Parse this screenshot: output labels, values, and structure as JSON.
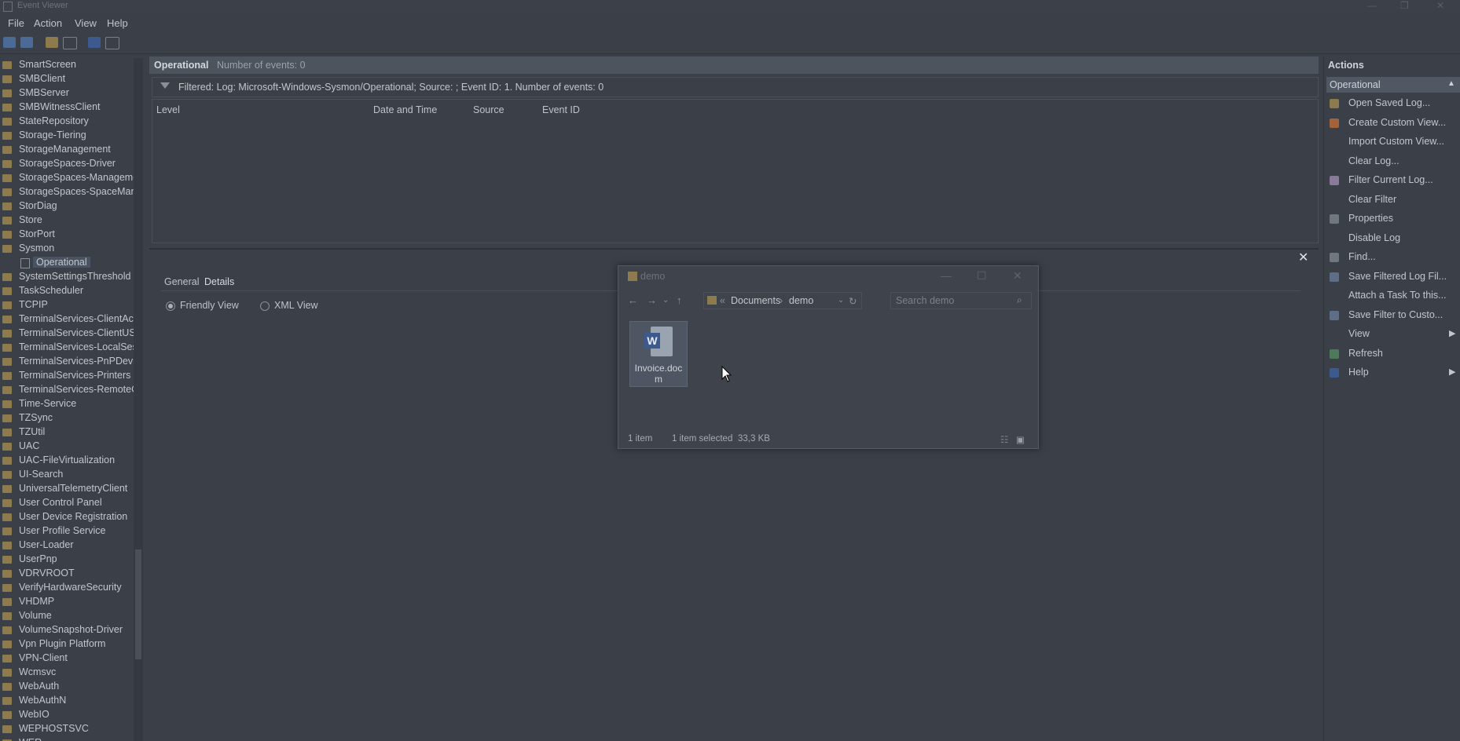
{
  "window": {
    "title": "Event Viewer"
  },
  "menu": [
    "File",
    "Action",
    "View",
    "Help"
  ],
  "tree": {
    "items": [
      "SmartScreen",
      "SMBClient",
      "SMBServer",
      "SMBWitnessClient",
      "StateRepository",
      "Storage-Tiering",
      "StorageManagement",
      "StorageSpaces-Driver",
      "StorageSpaces-Manageme",
      "StorageSpaces-SpaceMana",
      "StorDiag",
      "Store",
      "StorPort",
      "Sysmon",
      "Operational",
      "SystemSettingsThreshold",
      "TaskScheduler",
      "TCPIP",
      "TerminalServices-ClientAct",
      "TerminalServices-ClientUSE",
      "TerminalServices-LocalSess",
      "TerminalServices-PnPDevic",
      "TerminalServices-Printers",
      "TerminalServices-RemoteC",
      "Time-Service",
      "TZSync",
      "TZUtil",
      "UAC",
      "UAC-FileVirtualization",
      "UI-Search",
      "UniversalTelemetryClient",
      "User Control Panel",
      "User Device Registration",
      "User Profile Service",
      "User-Loader",
      "UserPnp",
      "VDRVROOT",
      "VerifyHardwareSecurity",
      "VHDMP",
      "Volume",
      "VolumeSnapshot-Driver",
      "Vpn Plugin Platform",
      "VPN-Client",
      "Wcmsvc",
      "WebAuth",
      "WebAuthN",
      "WebIO",
      "WEPHOSTSVC",
      "WER"
    ],
    "selected": "Operational"
  },
  "log": {
    "name": "Operational",
    "count_text": "Number of events: 0",
    "filter_text": "Filtered: Log: Microsoft-Windows-Sysmon/Operational; Source: ; Event ID: 1. Number of events: 0",
    "columns": [
      "Level",
      "Date and Time",
      "Source",
      "Event ID"
    ]
  },
  "details": {
    "tabs": [
      "General",
      "Details"
    ],
    "active_tab": "Details",
    "views": [
      "Friendly View",
      "XML View"
    ],
    "selected_view": "Friendly View"
  },
  "actions": {
    "title": "Actions",
    "section": "Operational",
    "items": [
      "Open Saved Log...",
      "Create Custom View...",
      "Import Custom View...",
      "Clear Log...",
      "Filter Current Log...",
      "Clear Filter",
      "Properties",
      "Disable Log",
      "Find...",
      "Save Filtered Log Fil...",
      "Attach a Task To this...",
      "Save Filter to Custo...",
      "View",
      "Refresh",
      "Help"
    ]
  },
  "explorer": {
    "title": "demo",
    "breadcrumb": [
      "Documents",
      "demo"
    ],
    "search_placeholder": "Search demo",
    "file_name": "Invoice.docm",
    "status_count": "1 item",
    "status_selected": "1 item selected",
    "status_size": "33,3 KB"
  }
}
